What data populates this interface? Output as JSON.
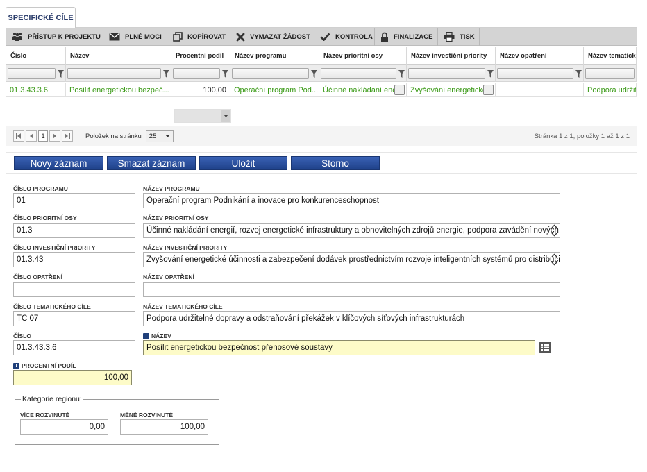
{
  "tab": {
    "label": "SPECIFICKÉ CÍLE"
  },
  "toolbar": [
    {
      "label": "PŘÍSTUP K PROJEKTU",
      "icon": "users-icon"
    },
    {
      "label": "PLNÉ MOCI",
      "icon": "envelope-icon"
    },
    {
      "label": "KOPÍROVAT",
      "icon": "copy-icon"
    },
    {
      "label": "VYMAZAT ŽÁDOST",
      "icon": "close-icon"
    },
    {
      "label": "KONTROLA",
      "icon": "check-icon"
    },
    {
      "label": "FINALIZACE",
      "icon": "lock-icon"
    },
    {
      "label": "TISK",
      "icon": "printer-icon"
    }
  ],
  "grid": {
    "columns": [
      "Číslo",
      "Název",
      "Procentní podíl",
      "Název programu",
      "Název prioritní osy",
      "Název investiční priority",
      "Název opatření",
      "Název tematického cíle"
    ],
    "rows": [
      [
        "01.3.43.3.6",
        "Posílit energetickou bezpeč...",
        "100,00",
        "Operační program Pod...",
        "Účinné nakládání energ",
        "Zvyšování energetické",
        "",
        "Podpora udržitelné"
      ]
    ]
  },
  "pager": {
    "page": "1",
    "per_page_label": "Položek na stránku",
    "per_page": "25",
    "info": "Stránka 1 z 1, položky 1 až 1 z 1"
  },
  "actions": {
    "new": "Nový záznam",
    "delete": "Smazat záznam",
    "save": "Uložit",
    "cancel": "Storno"
  },
  "form": {
    "cislo_programu": {
      "label": "ČÍSLO PROGRAMU",
      "value": "01"
    },
    "nazev_programu": {
      "label": "NÁZEV PROGRAMU",
      "value": "Operační program Podnikání a inovace pro konkurenceschopnost"
    },
    "cislo_osy": {
      "label": "ČÍSLO PRIORITNÍ OSY",
      "value": "01.3"
    },
    "nazev_osy": {
      "label": "NÁZEV PRIORITNÍ OSY",
      "value": "Účinné nakládání energií, rozvoj energetické infrastruktury a obnovitelných zdrojů energie, podpora zavádění nových"
    },
    "cislo_priority": {
      "label": "ČÍSLO INVESTIČNÍ PRIORITY",
      "value": "01.3.43"
    },
    "nazev_priority": {
      "label": "NÁZEV INVESTIČNÍ PRIORITY",
      "value": "Zvyšování energetické účinnosti a zabezpečení dodávek prostřednictvím rozvoje inteligentních systémů pro distribuci,"
    },
    "cislo_opatreni": {
      "label": "ČÍSLO OPATŘENÍ",
      "value": ""
    },
    "nazev_opatreni": {
      "label": "NÁZEV OPATŘENÍ",
      "value": ""
    },
    "cislo_cile": {
      "label": "ČÍSLO TEMATICKÉHO CÍLE",
      "value": "TC 07"
    },
    "nazev_cile": {
      "label": "NÁZEV TEMATICKÉHO CÍLE",
      "value": "Podpora udržitelné dopravy a odstraňování překážek v klíčových síťových infrastrukturách"
    },
    "cislo": {
      "label": "ČÍSLO",
      "value": "01.3.43.3.6"
    },
    "nazev": {
      "label": "NÁZEV",
      "value": "Posílit energetickou bezpečnost přenosové soustavy"
    },
    "podil": {
      "label": "PROCENTNÍ PODÍL",
      "value": "100,00"
    }
  },
  "region": {
    "legend": "Kategorie regionu:",
    "more_label": "VÍCE ROZVINUTÉ",
    "more_value": "0,00",
    "less_label": "MÉNĚ ROZVINUTÉ",
    "less_value": "100,00"
  },
  "colors": {
    "accent": "#2b4f9c",
    "grid_text": "#3b9a17",
    "required_bg": "#fdfbc8",
    "toolbar_bg": "#d4d4d4"
  }
}
